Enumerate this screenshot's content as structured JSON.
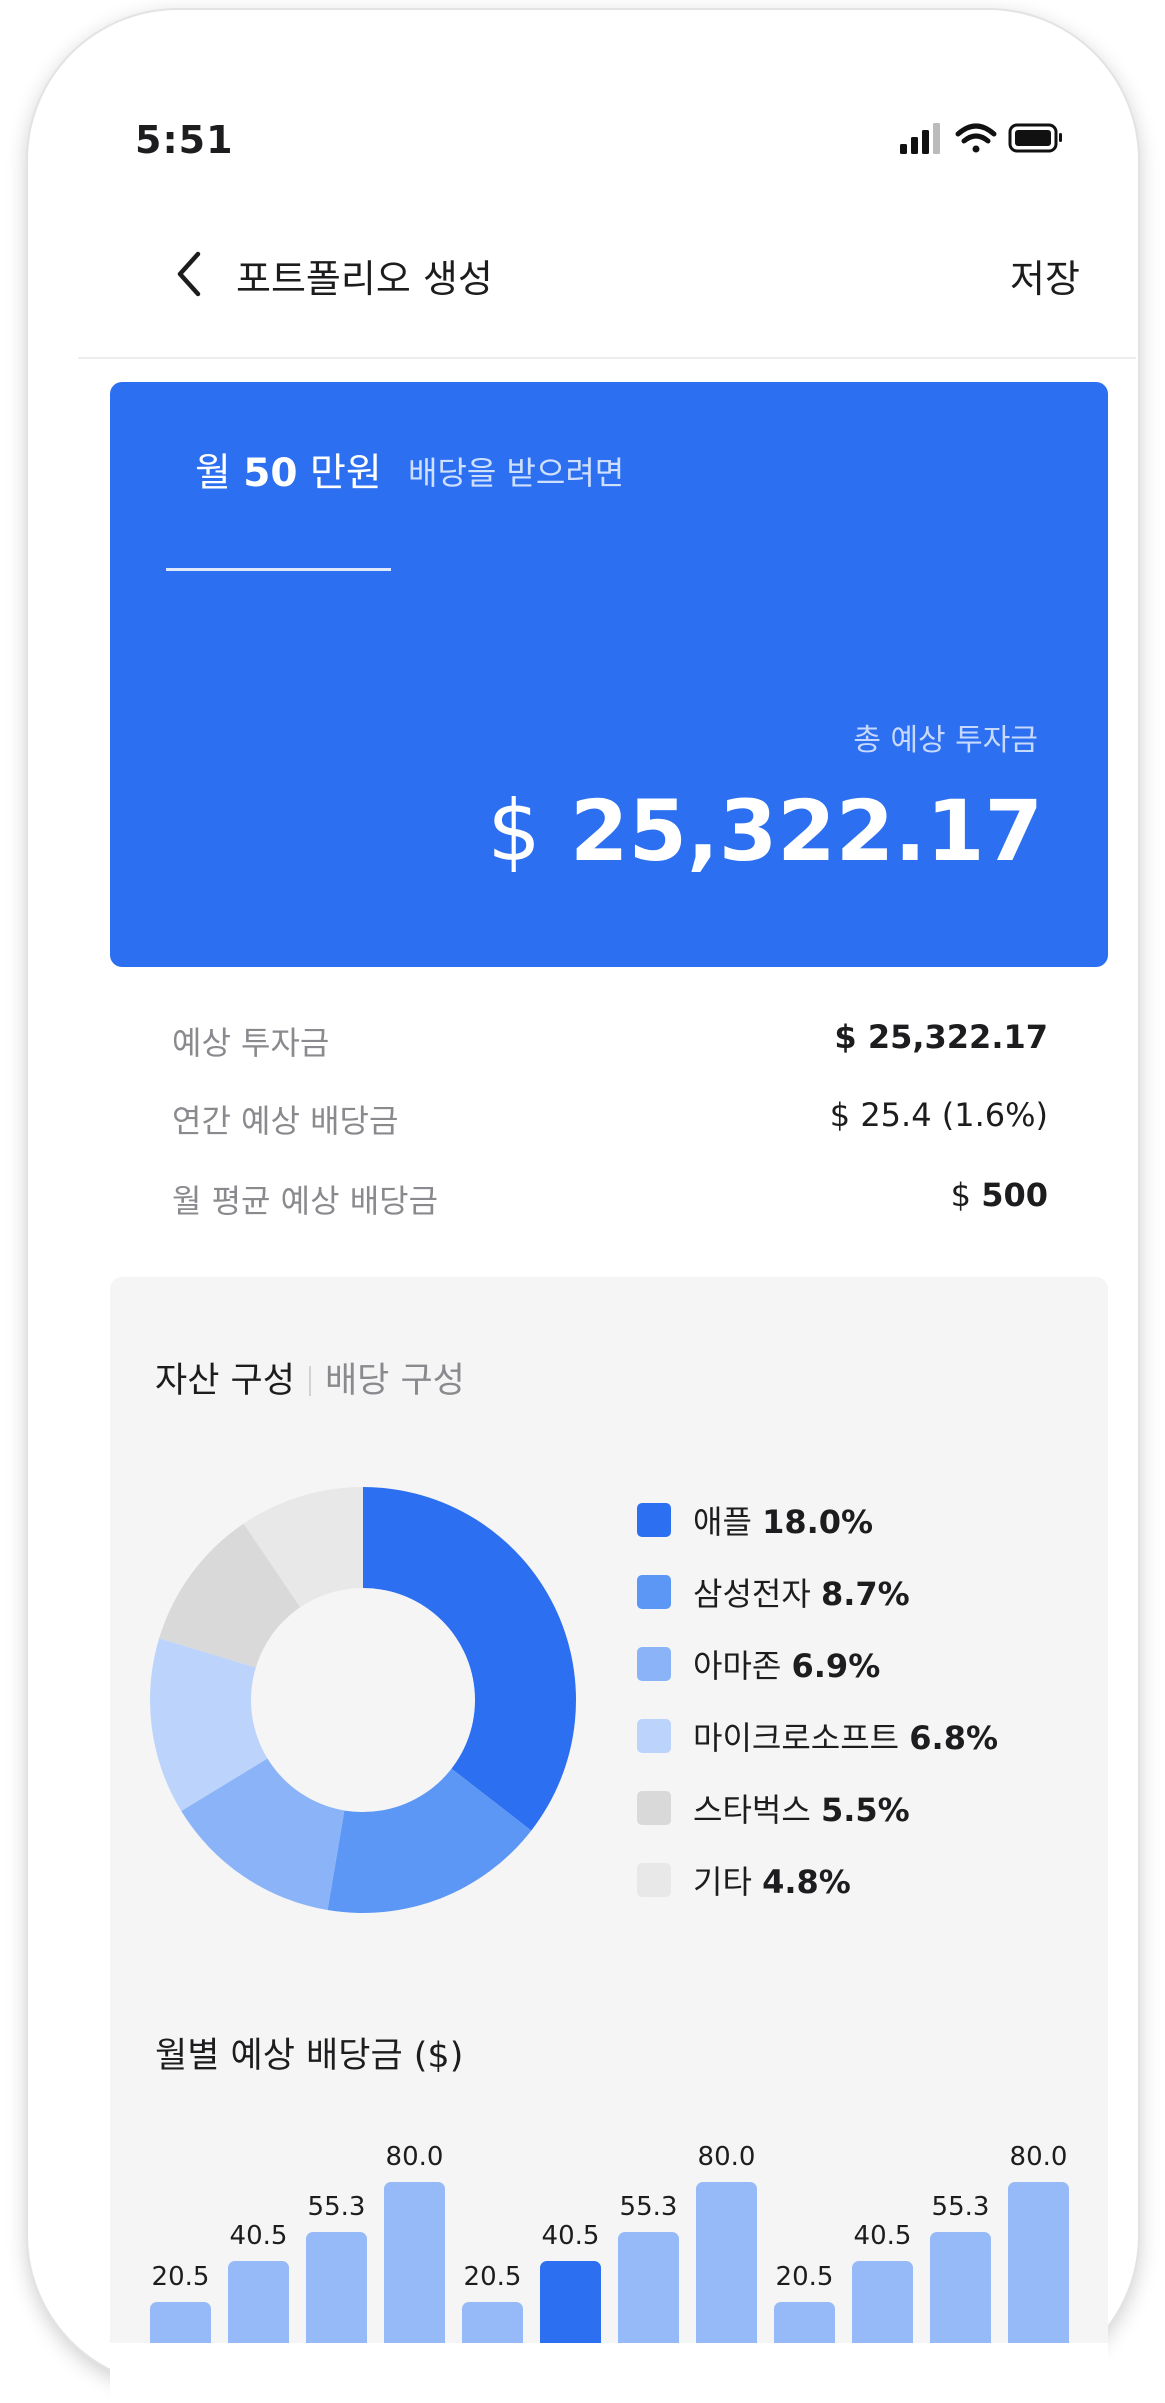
{
  "status_bar": {
    "time": "5:51",
    "icons": [
      "signal-icon",
      "wifi-icon",
      "battery-icon"
    ]
  },
  "nav": {
    "back_icon": "chevron-left-icon",
    "title": "포트폴리오 생성",
    "save": "저장"
  },
  "hero": {
    "prefix": "월",
    "amount": "50",
    "unit": "만원",
    "suffix": "배당을 받으려면",
    "total_label": "총 예상 투자금",
    "total_currency": "$",
    "total_value": "25,322.17",
    "background": "#2c6ff0"
  },
  "summary": [
    {
      "label": "예상 투자금",
      "value": "$ 25,322.17"
    },
    {
      "label": "연간 예상 배당금",
      "value": "$ 25.4 (1.6%)"
    },
    {
      "label": "월 평균 예상 배당금",
      "currency": "$",
      "amount": "500"
    }
  ],
  "composition": {
    "tabs": [
      "자산 구성",
      "배당 구성"
    ],
    "active_tab": "자산 구성",
    "legend": [
      {
        "name": "애플",
        "value": "18.0%",
        "color": "#2c6ff0"
      },
      {
        "name": "삼성전자",
        "value": "8.7%",
        "color": "#5c97f5"
      },
      {
        "name": "아마존",
        "value": "6.9%",
        "color": "#8bb4f8"
      },
      {
        "name": "마이크로소프트",
        "value": "6.8%",
        "color": "#bcd4fb"
      },
      {
        "name": "스타벅스",
        "value": "5.5%",
        "color": "#d9d9d9"
      },
      {
        "name": "기타",
        "value": "4.8%",
        "color": "#e8e8e8"
      }
    ]
  },
  "chart_data": {
    "type": "bar",
    "title": "월별 예상 배당금 ($)",
    "values": [
      20.5,
      40.5,
      55.3,
      80.0,
      20.5,
      40.5,
      55.3,
      80.0,
      20.5,
      40.5,
      55.3,
      80.0
    ],
    "labels": [
      "20.5",
      "40.5",
      "55.3",
      "80.0",
      "20.5",
      "40.5",
      "55.3",
      "80.0",
      "20.5",
      "40.5",
      "55.3",
      "80.0"
    ],
    "highlight_index": 5,
    "bar_color": "#96b9f8",
    "highlight_color": "#2c6ff0",
    "ylim": [
      0,
      80
    ]
  }
}
